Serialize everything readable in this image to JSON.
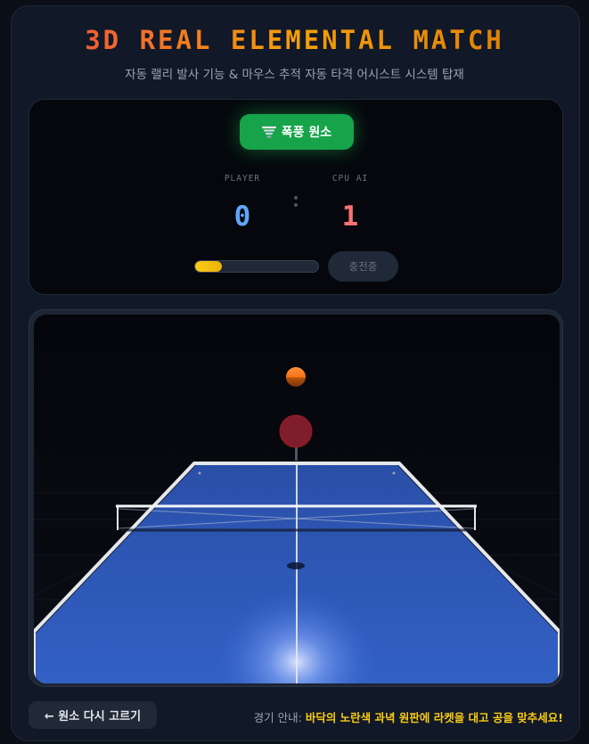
{
  "header": {
    "title": "3D REAL ELEMENTAL MATCH",
    "subtitle": "자동 랠리 발사 기능 & 마우스 추적 자동 타격 어시스트 시스템 탑재"
  },
  "scoreboard": {
    "element_button": {
      "icon": "tornado-icon",
      "label": "폭풍 원소",
      "color": "#16a34a"
    },
    "player_label": "PLAYER",
    "cpu_label": "CPU AI",
    "player_score": "0",
    "cpu_score": "1",
    "charge_fraction": 0.22,
    "charge_button_label": "충전중"
  },
  "footer": {
    "back_button_label": "← 원소 다시 고르기",
    "hint_label": "경기 안내:",
    "hint_text": "바닥의 노란색 과녁 원판에 라켓을 대고 공을 맞추세요!"
  },
  "colors": {
    "table": "#2f58b8",
    "player": "#60a5fa",
    "cpu": "#f87171",
    "ball": "#f97316",
    "cpu_paddle": "#7f1d2d",
    "accent_green": "#16a34a"
  }
}
